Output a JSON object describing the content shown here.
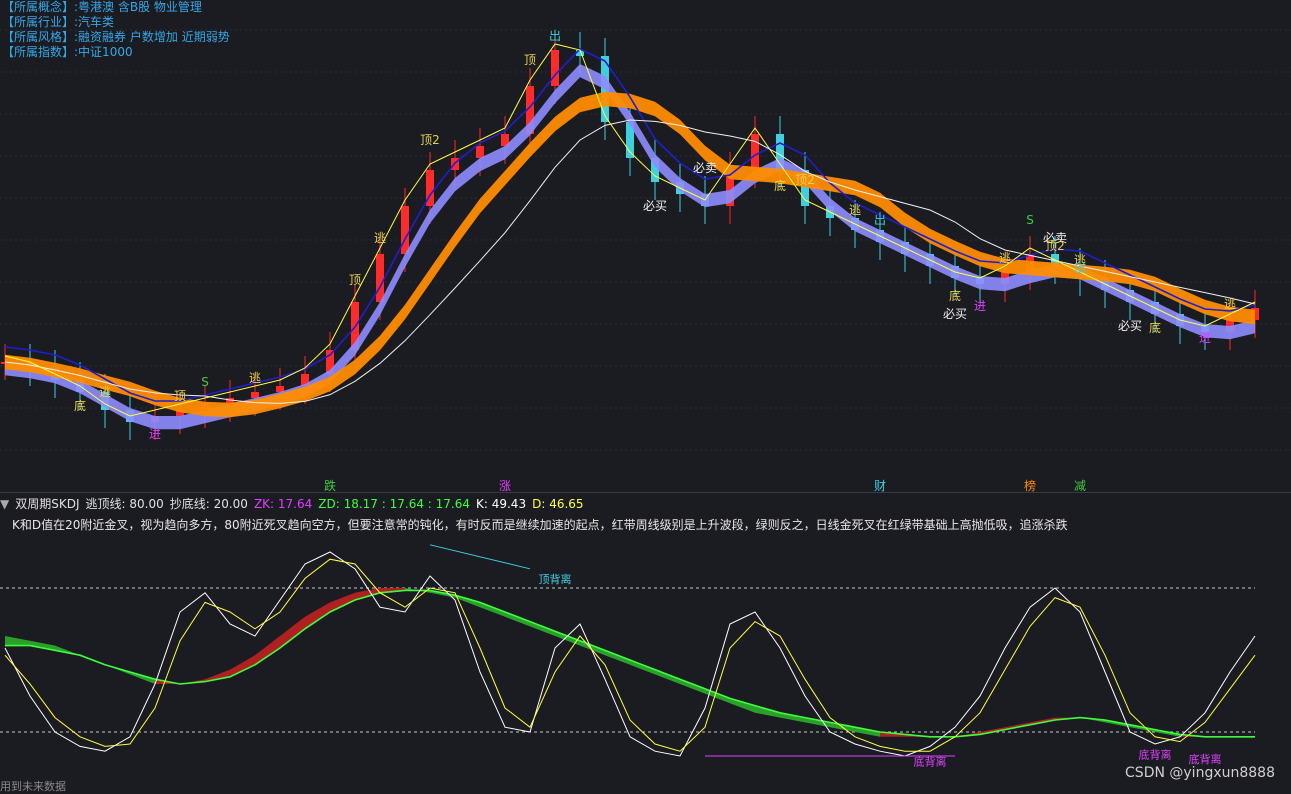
{
  "info_panel": [
    {
      "key": "【所属概念】",
      "value": ":粤港澳 含B股 物业管理"
    },
    {
      "key": "【所属行业】",
      "value": ":汽车类"
    },
    {
      "key": "【所属风格】",
      "value": ":融资融券 户数增加 近期弱势"
    },
    {
      "key": "【所属指数】",
      "value": ":中证1000"
    }
  ],
  "indicator": {
    "name": "双周期SKDJ",
    "escape_line": "逃顶线: 80.00",
    "bottom_line": "抄底线: 20.00",
    "zk": "ZK: 17.64",
    "zd": "ZD: 18.17 : 17.64 : 17.64",
    "k": "K: 49.43",
    "d": "D: 46.65",
    "description": "K和D值在20附近金叉，视为趋向多方，80附近死叉趋向空方，但要注意常的钝化，有时反而是继续加速的起点，红带周线级别是上升波段，绿则反之，日线金死叉在红绿带基础上高抛低吸，追涨杀跌"
  },
  "footer_left": "用到未来数据",
  "watermark": "CSDN @yingxun8888",
  "colors": {
    "background": "#1b1b22",
    "up_candle": "#ff2a2a",
    "down_candle": "#3fd0e0",
    "orange_band": "#ff8c00",
    "purple_band": "#8d8dff",
    "red_band": "#b02020",
    "green_band": "#2aa02a",
    "label_yellow": "#e8d24a"
  },
  "chart_data": [
    {
      "type": "line",
      "panel": "price",
      "x": [
        0,
        1,
        2,
        3,
        4,
        5,
        6,
        7,
        8,
        9,
        10,
        11,
        12,
        13,
        14,
        15,
        16,
        17,
        18,
        19,
        20,
        21,
        22,
        23,
        24,
        25,
        26,
        27,
        28,
        29,
        30,
        31,
        32,
        33,
        34,
        35,
        36,
        37,
        38,
        39,
        40,
        41,
        42,
        43,
        44,
        45,
        46,
        47,
        48,
        49,
        50
      ],
      "series": [
        {
          "name": "price",
          "values": [
            78,
            77,
            75,
            73,
            70,
            68,
            69,
            70,
            71,
            72,
            73,
            74,
            76,
            80,
            88,
            96,
            104,
            110,
            112,
            114,
            116,
            124,
            130,
            129,
            118,
            112,
            108,
            106,
            104,
            110,
            116,
            110,
            104,
            102,
            100,
            98,
            96,
            94,
            92,
            91,
            93,
            96,
            94,
            92,
            90,
            88,
            86,
            84,
            83,
            85,
            87
          ]
        }
      ],
      "labels_on_chart": [
        "顶",
        "顶",
        "顶2",
        "必卖",
        "逃",
        "逃",
        "出",
        "必买",
        "底",
        "进",
        "顶2",
        "逃",
        "出",
        "S",
        "必卖",
        "底",
        "逃",
        "必买",
        "底",
        "进",
        "逃",
        "S",
        "顶",
        "顶2",
        "逃",
        "出",
        "必买",
        "底",
        "进",
        "逃",
        "跌",
        "涨",
        "财",
        "榜",
        "减"
      ]
    },
    {
      "type": "line",
      "panel": "indicator",
      "ylim": [
        0,
        100
      ],
      "x": [
        0,
        1,
        2,
        3,
        4,
        5,
        6,
        7,
        8,
        9,
        10,
        11,
        12,
        13,
        14,
        15,
        16,
        17,
        18,
        19,
        20,
        21,
        22,
        23,
        24,
        25,
        26,
        27,
        28,
        29,
        30,
        31,
        32,
        33,
        34,
        35,
        36,
        37,
        38,
        39,
        40,
        41,
        42,
        43,
        44,
        45,
        46,
        47,
        48,
        49,
        50
      ],
      "series": [
        {
          "name": "K",
          "values": [
            55,
            35,
            20,
            14,
            12,
            18,
            40,
            70,
            78,
            65,
            60,
            75,
            90,
            95,
            88,
            72,
            70,
            85,
            75,
            45,
            22,
            20,
            55,
            65,
            42,
            18,
            12,
            10,
            30,
            65,
            70,
            55,
            35,
            20,
            15,
            12,
            10,
            14,
            22,
            35,
            55,
            72,
            80,
            70,
            45,
            20,
            15,
            18,
            28,
            45,
            60
          ]
        },
        {
          "name": "D",
          "values": [
            52,
            40,
            26,
            18,
            14,
            15,
            30,
            58,
            74,
            70,
            63,
            70,
            84,
            92,
            90,
            78,
            72,
            80,
            78,
            55,
            30,
            22,
            45,
            60,
            48,
            25,
            15,
            12,
            22,
            55,
            66,
            60,
            42,
            26,
            18,
            14,
            12,
            12,
            18,
            28,
            46,
            64,
            76,
            72,
            52,
            28,
            18,
            16,
            24,
            38,
            52
          ]
        },
        {
          "name": "ZK",
          "values": [
            60,
            58,
            56,
            52,
            48,
            44,
            40,
            40,
            42,
            46,
            52,
            60,
            68,
            74,
            78,
            80,
            80,
            78,
            76,
            72,
            68,
            64,
            60,
            56,
            52,
            48,
            44,
            40,
            36,
            32,
            28,
            26,
            24,
            22,
            20,
            18,
            18,
            18,
            18,
            20,
            22,
            24,
            26,
            26,
            24,
            22,
            20,
            18,
            18,
            18,
            18
          ]
        },
        {
          "name": "ZD",
          "values": [
            56,
            56,
            54,
            52,
            48,
            45,
            42,
            40,
            41,
            43,
            48,
            55,
            63,
            70,
            75,
            78,
            79,
            79,
            77,
            74,
            70,
            66,
            62,
            58,
            54,
            50,
            46,
            42,
            38,
            34,
            31,
            28,
            26,
            24,
            22,
            20,
            19,
            18,
            18,
            19,
            21,
            23,
            25,
            26,
            25,
            23,
            21,
            19,
            18,
            18,
            18
          ]
        }
      ],
      "reference_lines": [
        80,
        20
      ],
      "annotations": [
        "顶背离",
        "底背离",
        "底背离",
        "底背离"
      ]
    }
  ]
}
